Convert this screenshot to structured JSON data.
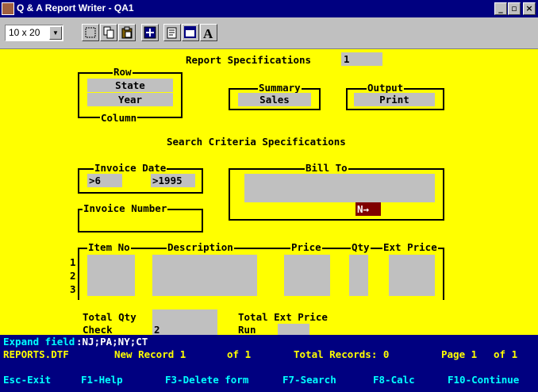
{
  "window": {
    "title": "Q & A Report Writer - QA1"
  },
  "toolbar": {
    "font_size": "10 x 20"
  },
  "report": {
    "heading": "Report Specifications",
    "number": "1",
    "row_label": "Row",
    "row_field1": "State",
    "row_field2": "Year",
    "column_label": "Column",
    "summary_label": "Summary",
    "summary_value": "Sales",
    "output_label": "Output",
    "output_value": "Print"
  },
  "search": {
    "heading": "Search Criteria Specifications",
    "invoice_date_label": "Invoice Date",
    "invoice_date_month": ">6",
    "invoice_date_day": "",
    "invoice_date_year": ">1995",
    "invoice_number_label": "Invoice Number",
    "bill_to_label": "Bill To",
    "bill_to_value": "N→"
  },
  "items": {
    "col_item": "Item No",
    "col_description": "Description",
    "col_price": "Price",
    "col_qty": "Qty",
    "col_ext": "Ext Price",
    "rows": [
      "1",
      "2",
      "3"
    ],
    "total_qty_label": "Total Qty",
    "total_ext_label": "Total Ext Price",
    "check_label": "Check",
    "check_value": "2",
    "run_label": "Run"
  },
  "status": {
    "expand_label": "Expand field",
    "expand_value": ":NJ;PA;NY;CT",
    "file": "REPORTS.DTF",
    "record": "New Record 1",
    "of": "of 1",
    "total_records": "Total Records: 0",
    "page": "Page 1",
    "page_of": "of 1"
  },
  "keys": [
    {
      "label": "Esc-Exit"
    },
    {
      "label": "F1-Help"
    },
    {
      "label": "F3-Delete form"
    },
    {
      "label": "F7-Search"
    },
    {
      "label": "F8-Calc"
    },
    {
      "label": "F10-Continue"
    }
  ]
}
